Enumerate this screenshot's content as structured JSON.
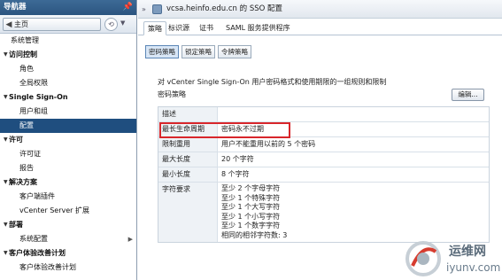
{
  "sidebar": {
    "title": "导航器",
    "back_label": "主页",
    "items": [
      {
        "label": "系统管理",
        "kind": "top"
      },
      {
        "label": "访问控制",
        "kind": "group"
      },
      {
        "label": "角色",
        "kind": "child"
      },
      {
        "label": "全局权限",
        "kind": "child"
      },
      {
        "label": "Single Sign-On",
        "kind": "group"
      },
      {
        "label": "用户和组",
        "kind": "child"
      },
      {
        "label": "配置",
        "kind": "child",
        "selected": true
      },
      {
        "label": "许可",
        "kind": "group"
      },
      {
        "label": "许可证",
        "kind": "child"
      },
      {
        "label": "报告",
        "kind": "child"
      },
      {
        "label": "解决方案",
        "kind": "group"
      },
      {
        "label": "客户端插件",
        "kind": "child"
      },
      {
        "label": "vCenter Server 扩展",
        "kind": "child"
      },
      {
        "label": "部署",
        "kind": "group"
      },
      {
        "label": "系统配置",
        "kind": "child",
        "has_arrow": true
      },
      {
        "label": "客户体验改善计划",
        "kind": "group"
      },
      {
        "label": "客户体验改善计划",
        "kind": "child"
      }
    ]
  },
  "main": {
    "title": "vcsa.heinfo.edu.cn 的 SSO 配置",
    "tabs": [
      {
        "label": "策略",
        "active": true
      },
      {
        "label": "标识源"
      },
      {
        "label": "证书"
      },
      {
        "label": "SAML 服务提供程序"
      }
    ],
    "subtabs": [
      {
        "label": "密码策略",
        "active": true
      },
      {
        "label": "锁定策略"
      },
      {
        "label": "令牌策略"
      }
    ],
    "description": "对 vCenter Single Sign-On 用户密码格式和使用期限的一组规则和限制",
    "policy_label": "密码策略",
    "edit_label": "编辑...",
    "table": [
      {
        "label": "描述",
        "value": ""
      },
      {
        "label": "最长生命周期",
        "value": "密码永不过期"
      },
      {
        "label": "限制重用",
        "value": "用户不能重用以前的 5 个密码"
      },
      {
        "label": "最大长度",
        "value": "20 个字符"
      },
      {
        "label": "最小长度",
        "value": "8 个字符"
      },
      {
        "label": "字符要求",
        "lines": [
          "至少 2 个字母字符",
          "至少 1 个特殊字符",
          "至少 1 个大写字符",
          "至少 1 个小写字符",
          "至少 1 个数字字符",
          "相同的相邻字符数: 3"
        ]
      }
    ]
  },
  "watermark": {
    "text": "运维网",
    "url": "iyunv.com"
  },
  "colors": {
    "nav_header": "#2b5580",
    "selected": "#1f4e7f",
    "highlight": "#d8262b"
  }
}
